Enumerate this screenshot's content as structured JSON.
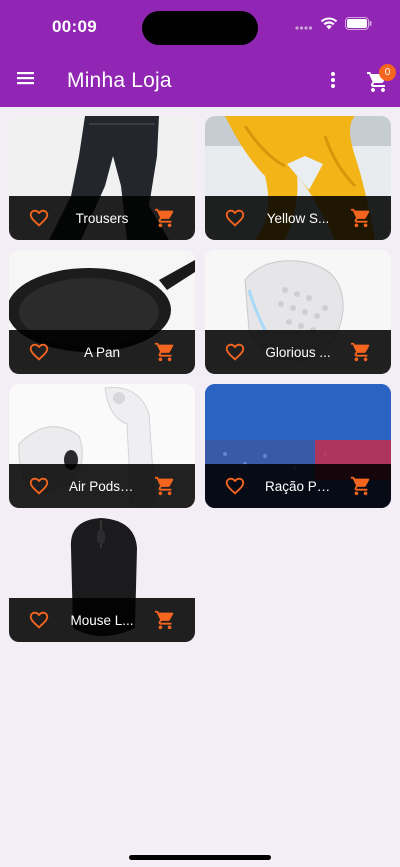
{
  "status_bar": {
    "time": "00:09"
  },
  "app_bar": {
    "title": "Minha Loja",
    "cart_count": "0"
  },
  "colors": {
    "primary": "#9126b4",
    "accent": "#f5651f",
    "footer": "#000000"
  },
  "products": [
    {
      "title": "Trousers",
      "image": "black-trousers"
    },
    {
      "title": "Yellow S...",
      "image": "yellow-scarf"
    },
    {
      "title": "A Pan",
      "image": "frying-pan"
    },
    {
      "title": "Glorious ...",
      "image": "white-gaming-mouse"
    },
    {
      "title": "Air Pods ...",
      "image": "airpods"
    },
    {
      "title": "Ração Pr...",
      "image": "premier-pet-food"
    },
    {
      "title": "Mouse L...",
      "image": "black-wireless-mouse"
    }
  ],
  "icons": {
    "menu": "hamburger-icon",
    "more": "more-vertical-icon",
    "cart": "shopping-cart-icon",
    "favorite": "heart-outline-icon",
    "add_to_cart": "shopping-cart-icon"
  }
}
